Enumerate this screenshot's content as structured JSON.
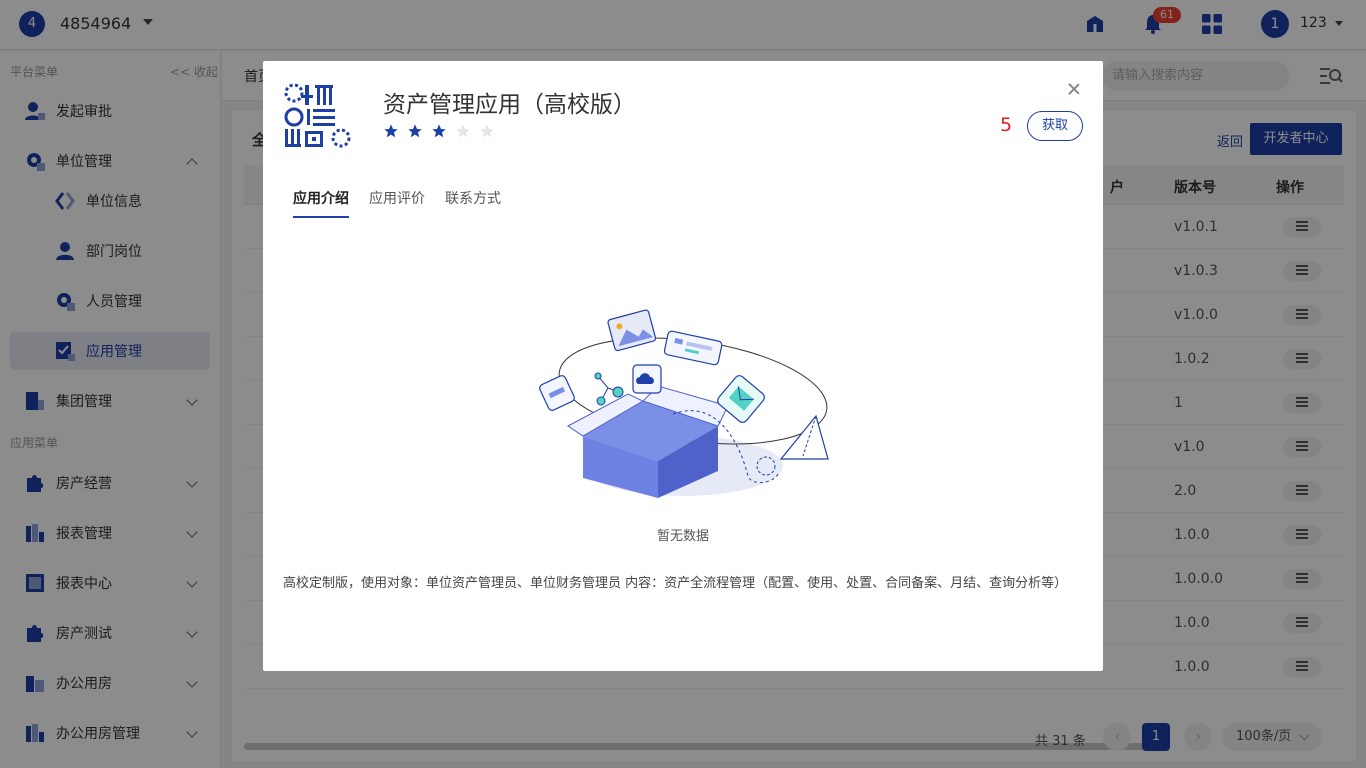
{
  "header": {
    "org_badge": "4",
    "org_name": "4854964",
    "notification_count": "61",
    "user_avatar": "1",
    "user_name": "123"
  },
  "sidebar": {
    "platform_section": "平台菜单",
    "collapse_label": "<< 收起",
    "app_section": "应用菜单",
    "items": [
      {
        "label": "发起审批"
      },
      {
        "label": "单位管理"
      },
      {
        "label": "单位信息"
      },
      {
        "label": "部门岗位"
      },
      {
        "label": "人员管理"
      },
      {
        "label": "应用管理"
      },
      {
        "label": "集团管理"
      },
      {
        "label": "房产经营"
      },
      {
        "label": "报表管理"
      },
      {
        "label": "报表中心"
      },
      {
        "label": "房产测试"
      },
      {
        "label": "办公用房"
      },
      {
        "label": "办公用房管理"
      }
    ]
  },
  "main": {
    "home_tab": "首页",
    "search_placeholder": "请输入搜索内容",
    "section_title": "全",
    "back_link": "返回",
    "dev_center_button": "开发者中心",
    "columns": {
      "partial": "户",
      "version": "版本号",
      "action": "操作"
    },
    "versions": [
      "v1.0.1",
      "v1.0.3",
      "v1.0.0",
      "1.0.2",
      "1",
      "v1.0",
      "2.0",
      "1.0.0",
      "1.0.0.0",
      "1.0.0",
      "1.0.0"
    ],
    "pagination": {
      "total": "共 31 条",
      "prev": "‹",
      "current": "1",
      "next": "›",
      "page_size": "100条/页"
    }
  },
  "modal": {
    "title": "资产管理应用（高校版）",
    "rating": 3,
    "rating_max": 5,
    "count": "5",
    "get_button": "获取",
    "tabs": [
      {
        "label": "应用介绍",
        "active": true
      },
      {
        "label": "应用评价",
        "active": false
      },
      {
        "label": "联系方式",
        "active": false
      }
    ],
    "empty_text": "暂无数据",
    "description": "高校定制版，使用对象：单位资产管理员、单位财务管理员 内容：资产全流程管理（配置、使用、处置、合同备案、月结、查询分析等）"
  },
  "colors": {
    "primary": "#1e3fa8",
    "star_filled": "#1e3fa8",
    "star_empty": "#e5e5e5",
    "badge_red": "#f04134",
    "count_red": "#e02020",
    "active_menu_bg": "#e6eaf5"
  }
}
